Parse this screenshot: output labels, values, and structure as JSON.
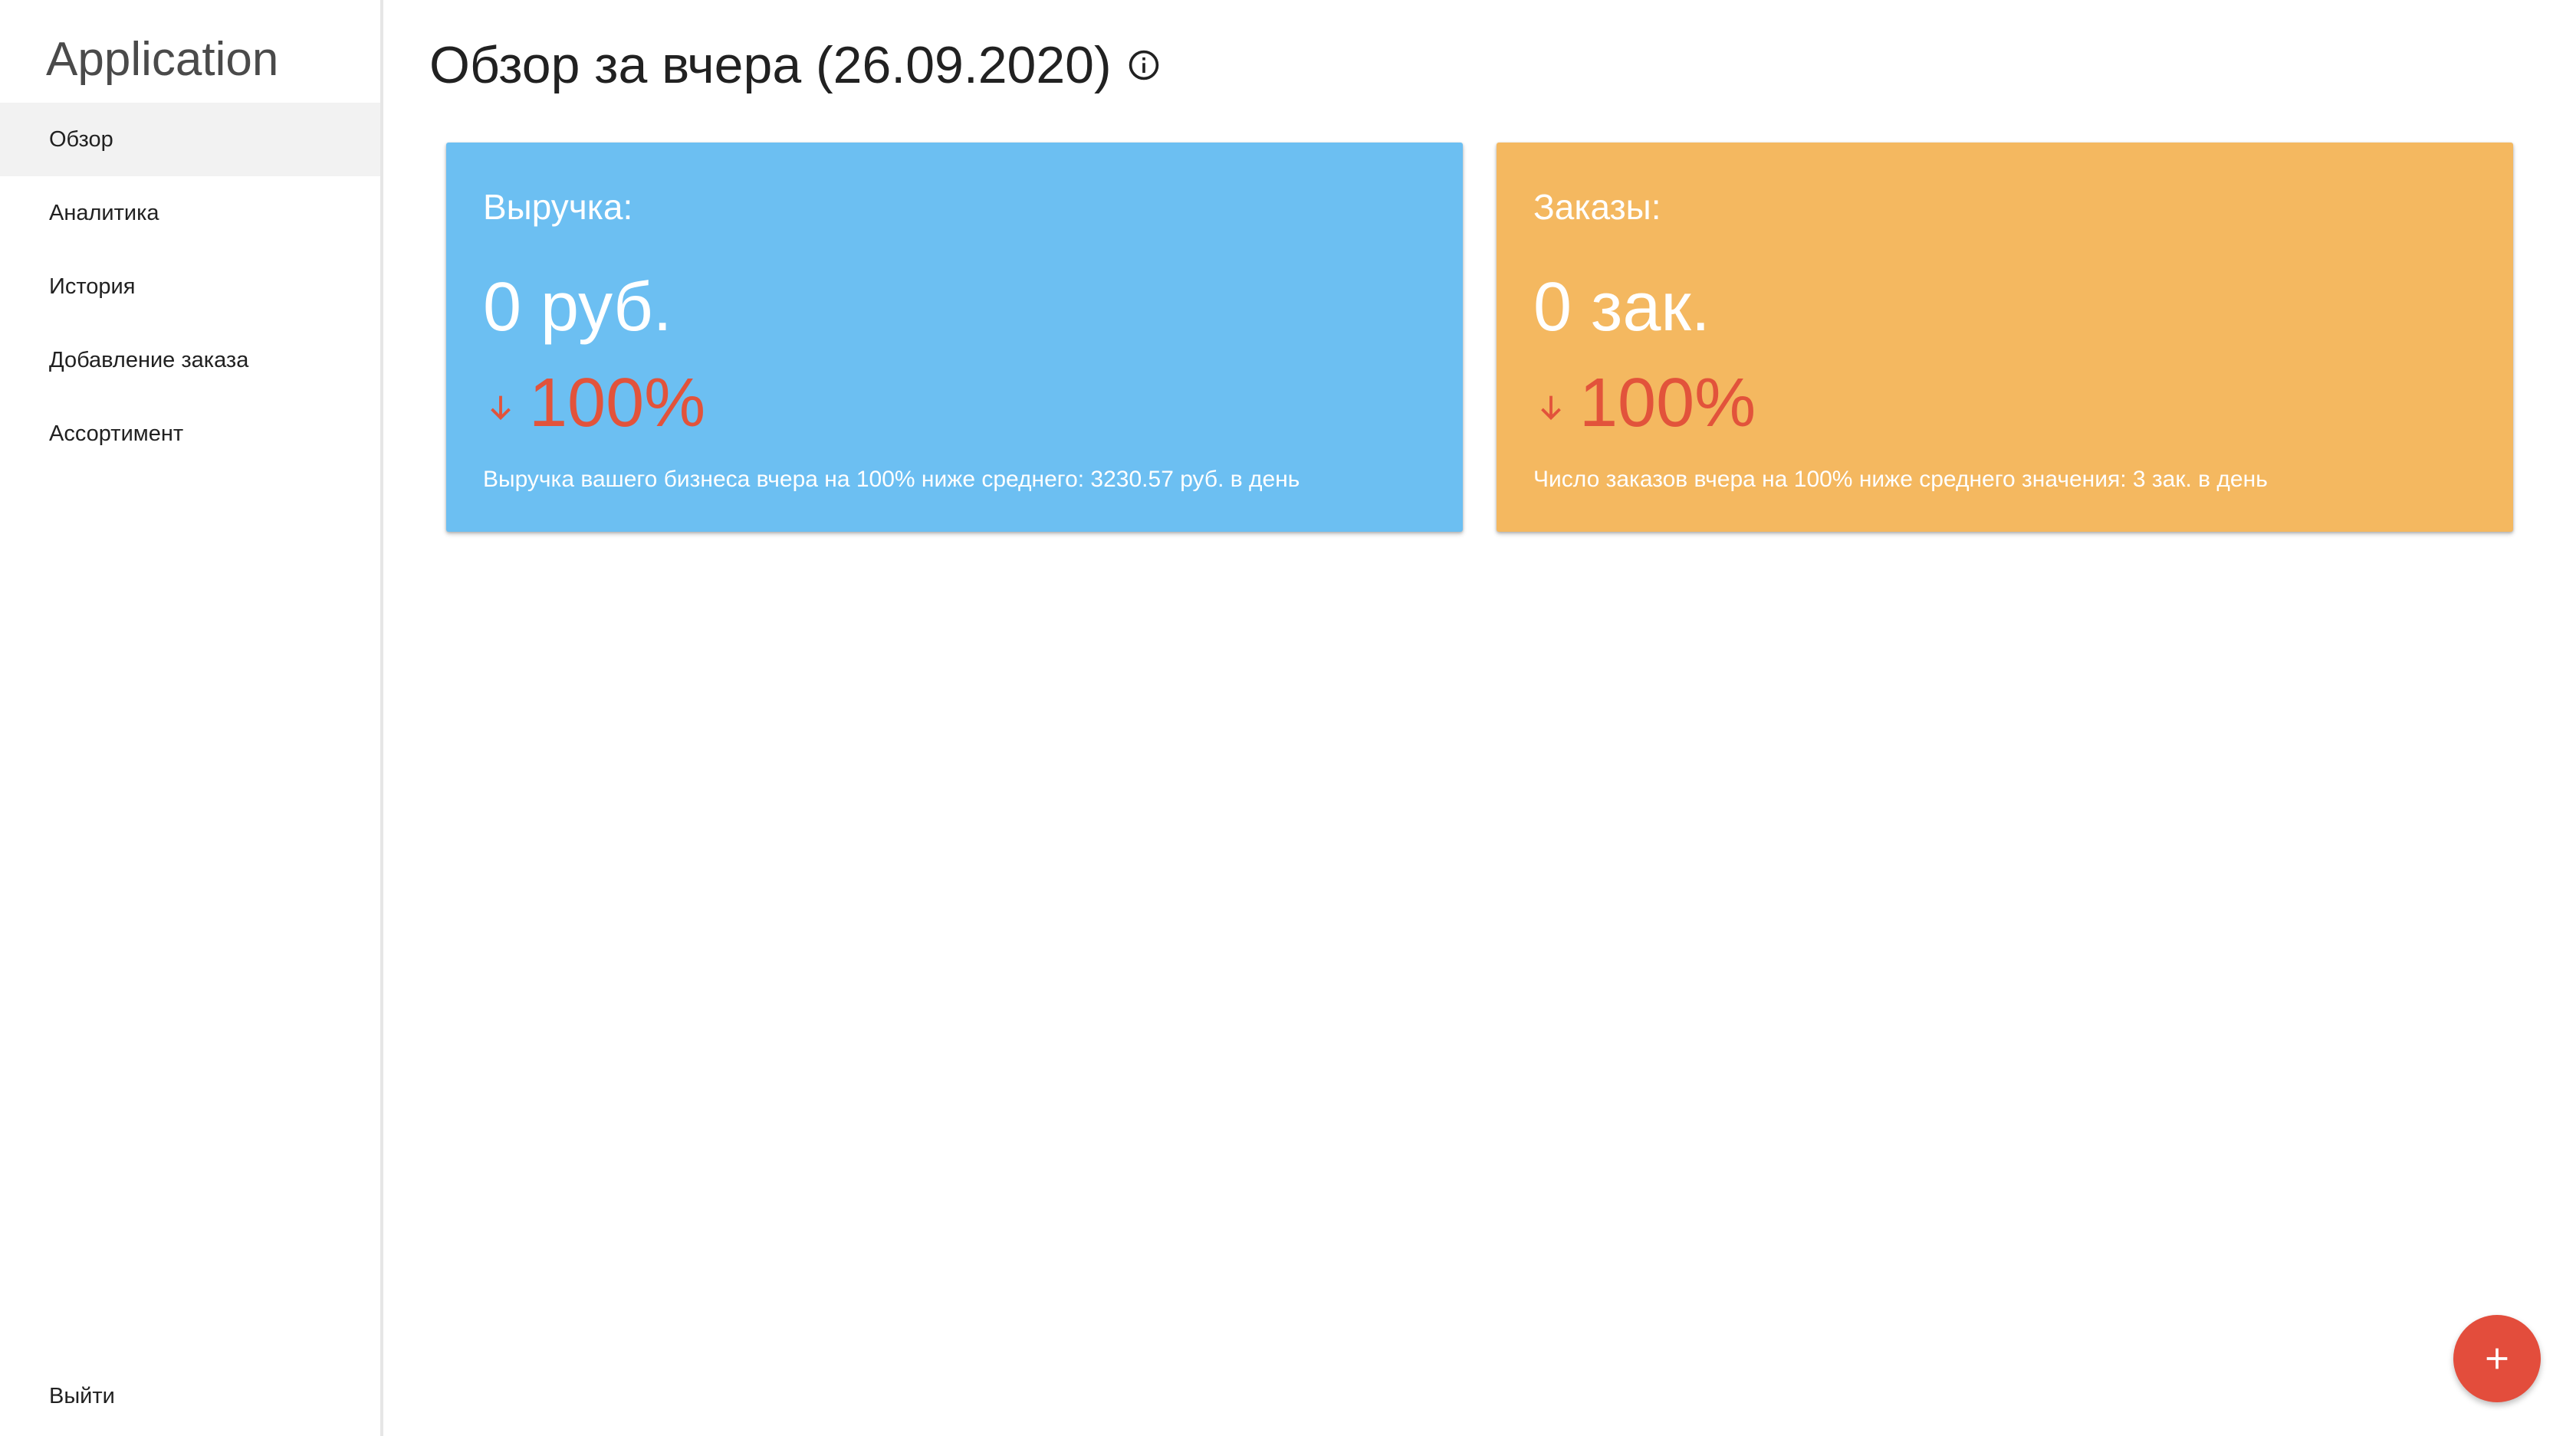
{
  "sidebar": {
    "app_title": "Application",
    "items": [
      {
        "label": "Обзор",
        "active": true
      },
      {
        "label": "Аналитика",
        "active": false
      },
      {
        "label": "История",
        "active": false
      },
      {
        "label": "Добавление заказа",
        "active": false
      },
      {
        "label": "Ассортимент",
        "active": false
      }
    ],
    "logout_label": "Выйти"
  },
  "header": {
    "title": "Обзор за вчера (26.09.2020)",
    "info_icon": "info-circle-icon"
  },
  "cards": {
    "revenue": {
      "label": "Выручка:",
      "value": "0 руб.",
      "change_icon": "arrow-down-icon",
      "change": "100%",
      "description": "Выручка вашего бизнеса вчера на 100% ниже среднего: 3230.57 руб. в день",
      "background": "#6cbff2"
    },
    "orders": {
      "label": "Заказы:",
      "value": "0 зак.",
      "change_icon": "arrow-down-icon",
      "change": "100%",
      "description": "Число заказов вчера на 100% ниже среднего значения: 3 зак. в день",
      "background": "#f4b860"
    }
  },
  "colors": {
    "negative": "#e2533b",
    "fab": "#e34d3c",
    "active_nav_bg": "#f2f2f2"
  },
  "fab": {
    "icon": "plus-icon"
  }
}
